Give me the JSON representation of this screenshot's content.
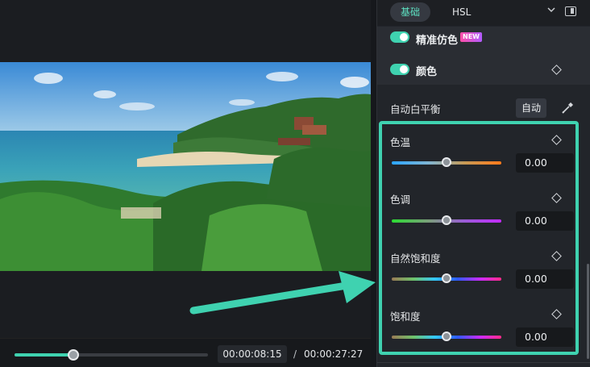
{
  "player": {
    "progress": 0.305,
    "current_time": "00:00:08:15",
    "separator": "/",
    "total_time": "00:00:27:27"
  },
  "panel": {
    "tabs": [
      {
        "label": "基础",
        "active": true
      },
      {
        "label": "HSL",
        "active": false
      }
    ],
    "ai_color_match": {
      "label": "精准仿色",
      "badge": "NEW",
      "enabled": true
    },
    "color": {
      "label": "颜色",
      "enabled": true
    },
    "auto_white_balance": {
      "label": "自动白平衡",
      "button": "自动"
    },
    "adjustments": [
      {
        "label": "色温",
        "value": "0.00",
        "level": 0.5
      },
      {
        "label": "色调",
        "value": "0.00",
        "level": 0.5
      },
      {
        "label": "自然饱和度",
        "value": "0.00",
        "level": 0.5
      },
      {
        "label": "饱和度",
        "value": "0.00",
        "level": 0.5
      }
    ]
  },
  "colors": {
    "accent": "#3fd2b0",
    "panel_bg": "#22252a",
    "badge_gradient": [
      "#ff4fa8",
      "#b25bff"
    ]
  },
  "icons": [
    "chevron-down-icon",
    "panel-layout-icon",
    "keyframe-diamond-icon",
    "eyedropper-icon",
    "annotation-arrow"
  ]
}
